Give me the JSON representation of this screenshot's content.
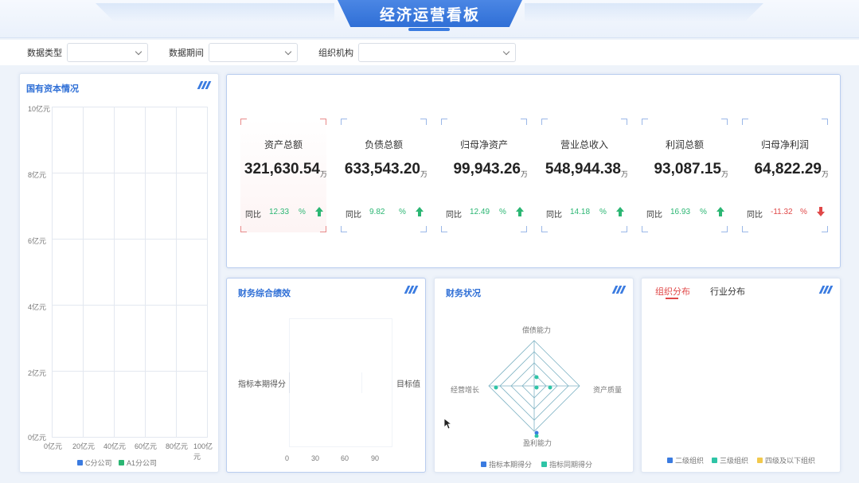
{
  "header": {
    "title": "经济运营看板"
  },
  "filters": [
    {
      "label": "数据类型",
      "value": ""
    },
    {
      "label": "数据期间",
      "value": ""
    },
    {
      "label": "组织机构",
      "value": ""
    }
  ],
  "state_capital": {
    "title": "国有资本情况",
    "chart_data": {
      "type": "bar",
      "orientation": "horizontal",
      "title": "国有资本情况",
      "y_ticks": [
        "10亿元",
        "8亿元",
        "6亿元",
        "4亿元",
        "2亿元",
        "0亿元"
      ],
      "x_ticks": [
        "0亿元",
        "20亿元",
        "40亿元",
        "60亿元",
        "80亿元",
        "100亿元"
      ],
      "series": [
        {
          "name": "C分公司",
          "values": [],
          "color": "#3a7be0"
        },
        {
          "name": "A1分公司",
          "values": [],
          "color": "#2bb673"
        }
      ]
    }
  },
  "kpis": [
    {
      "label": "资产总额",
      "value": "321,630.54",
      "unit": "万",
      "yoy_label": "同比",
      "pct": "12.33",
      "pct_sign": "%",
      "trend": "up"
    },
    {
      "label": "负债总额",
      "value": "633,543.20",
      "unit": "万",
      "yoy_label": "同比",
      "pct": "9.82",
      "pct_sign": "%",
      "trend": "up"
    },
    {
      "label": "归母净资产",
      "value": "99,943.26",
      "unit": "万",
      "yoy_label": "同比",
      "pct": "12.49",
      "pct_sign": "%",
      "trend": "up"
    },
    {
      "label": "营业总收入",
      "value": "548,944.38",
      "unit": "万",
      "yoy_label": "同比",
      "pct": "14.18",
      "pct_sign": "%",
      "trend": "up"
    },
    {
      "label": "利润总额",
      "value": "93,087.15",
      "unit": "万",
      "yoy_label": "同比",
      "pct": "16.93",
      "pct_sign": "%",
      "trend": "up"
    },
    {
      "label": "归母净利润",
      "value": "64,822.29",
      "unit": "万",
      "yoy_label": "同比",
      "pct": "-11.32",
      "pct_sign": "%",
      "trend": "down"
    }
  ],
  "performance": {
    "title": "财务综合绩效",
    "chart_data": {
      "type": "bar",
      "title": "财务综合绩效",
      "y_labels": [
        "指标本期得分",
        "目标值"
      ],
      "x_ticks": [
        "0",
        "30",
        "60",
        "90"
      ],
      "series": []
    }
  },
  "financial": {
    "title": "财务状况",
    "chart_data": {
      "type": "radar",
      "title": "财务状况",
      "axes": [
        "偿债能力",
        "资产质量",
        "盈利能力",
        "经营增长"
      ],
      "series": [
        {
          "name": "指标本期得分",
          "color": "#3a7be0"
        },
        {
          "name": "指标同期得分",
          "color": "#2ec4a6"
        }
      ]
    }
  },
  "distribution": {
    "tabs": [
      {
        "label": "组织分布",
        "active": true
      },
      {
        "label": "行业分布",
        "active": false
      }
    ],
    "legend": [
      {
        "name": "二级组织",
        "color": "#3a7be0"
      },
      {
        "name": "三级组织",
        "color": "#2ec4a6"
      },
      {
        "name": "四级及以下组织",
        "color": "#f2c94c"
      }
    ]
  }
}
